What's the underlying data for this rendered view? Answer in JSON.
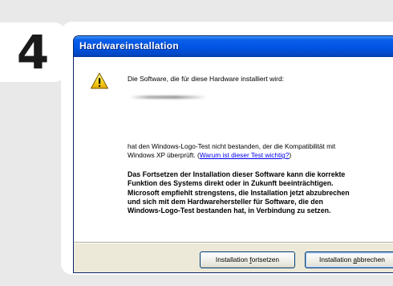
{
  "step": {
    "number": "4"
  },
  "dialog": {
    "title": "Hardwareinstallation",
    "intro": "Die Software, die für diese Hardware installiert wird:",
    "notice_line1": "hat den Windows-Logo-Test nicht bestanden, der die Kompatibilität mit",
    "notice_line2_prefix": "Windows XP überprüft. (",
    "notice_link": "Warum ist dieser Test wichtig?",
    "notice_line2_suffix": ")",
    "warning_lines": [
      "Das Fortsetzen der Installation dieser Software kann die korrekte",
      "Funktion des Systems direkt oder in Zukunft beeinträchtigen.",
      "Microsoft empfiehlt strengstens, die Installation jetzt abzubrechen",
      "und sich mit dem Hardwarehersteller für Software, die den",
      "Windows-Logo-Test bestanden hat, in Verbindung zu setzen."
    ],
    "icon": "warning-icon"
  },
  "buttons": {
    "continue_pre": "Installation ",
    "continue_key": "f",
    "continue_post": "ortsetzen",
    "cancel_pre": "Installation ",
    "cancel_key": "a",
    "cancel_post": "bbrechen"
  },
  "colors": {
    "titlebar": "#0054e3",
    "dialog_face": "#ece9d8",
    "link": "#0000ee",
    "background": "#e9e9e9"
  }
}
